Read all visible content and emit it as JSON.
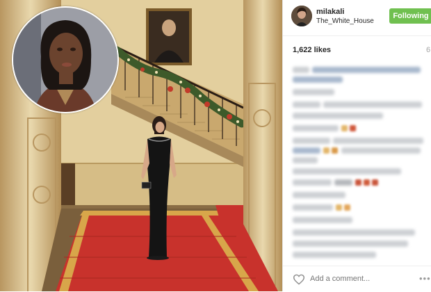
{
  "post": {
    "username": "milakali",
    "location": "The_White_House",
    "follow_label": "Following",
    "likes": "1,622 likes",
    "age": "6",
    "comment_placeholder": "Add a comment...",
    "more_label": "•••"
  },
  "icons": {
    "like": "heart-outline-icon",
    "more": "more-options-icon"
  },
  "colors": {
    "follow_button": "#70c050",
    "carpet": "#c8322c",
    "wall": "#d9c08a",
    "dress": "#141414"
  }
}
